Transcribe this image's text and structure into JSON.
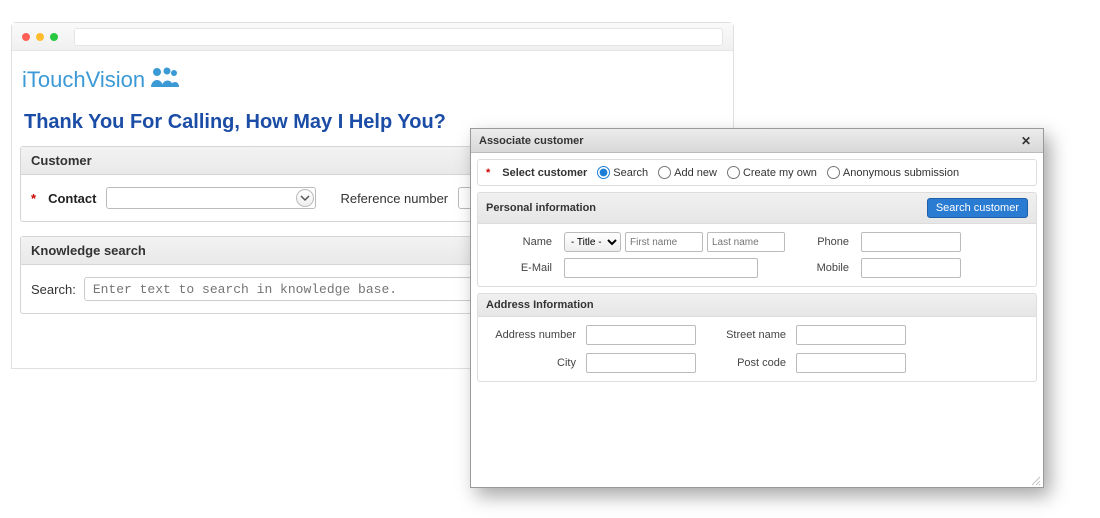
{
  "logo": {
    "text": "iTouchVision"
  },
  "heading": "Thank You For Calling, How May I Help You?",
  "customer_panel": {
    "title": "Customer",
    "contact_label": "Contact",
    "contact_value": "",
    "reference_label": "Reference number",
    "reference_value": ""
  },
  "knowledge_panel": {
    "title": "Knowledge search",
    "search_label": "Search:",
    "search_placeholder": "Enter text to search in knowledge base."
  },
  "dialog": {
    "title": "Associate customer",
    "select_customer_label": "Select customer",
    "radios": {
      "search": "Search",
      "add_new": "Add new",
      "create_my_own": "Create my own",
      "anonymous": "Anonymous submission"
    },
    "selected_radio": "search",
    "personal_section": {
      "title": "Personal information",
      "search_button": "Search customer",
      "name_label": "Name",
      "title_select": "- Title -",
      "first_name_placeholder": "First name",
      "last_name_placeholder": "Last name",
      "phone_label": "Phone",
      "email_label": "E-Mail",
      "mobile_label": "Mobile"
    },
    "address_section": {
      "title": "Address Information",
      "address_number_label": "Address number",
      "street_name_label": "Street name",
      "city_label": "City",
      "post_code_label": "Post code"
    }
  }
}
